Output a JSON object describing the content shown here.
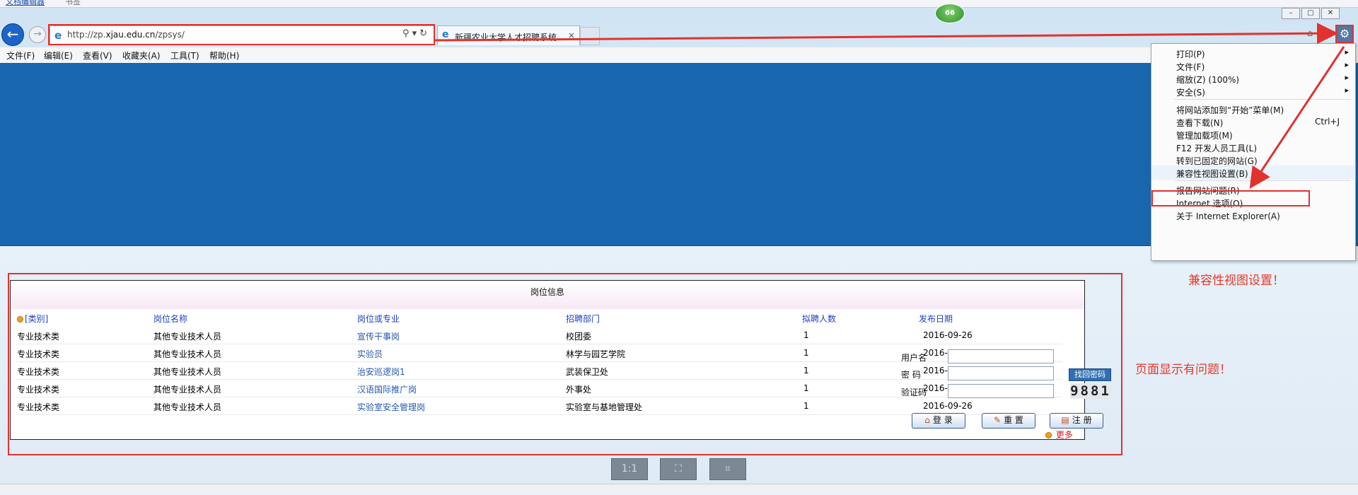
{
  "topbar": {
    "link_text": "文档编辑器",
    "sep_text": "书签",
    "badge": "66"
  },
  "browser": {
    "url_prefix": "http://zp.",
    "url_domain": "xjau.edu.cn",
    "url_path": "/zpsys/",
    "tab_title": "新疆农业大学人才招聘系统",
    "tab_close": "×"
  },
  "menubar": [
    "文件(F)",
    "编辑(E)",
    "查看(V)",
    "收藏夹(A)",
    "工具(T)",
    "帮助(H)"
  ],
  "panel": {
    "title": "岗位信息",
    "headers": [
      "[类别]",
      "岗位名称",
      "岗位或专业",
      "招聘部门",
      "拟聘人数",
      "发布日期"
    ],
    "rows": [
      [
        "专业技术类",
        "其他专业技术人员",
        "宣传干事岗",
        "校团委",
        "1",
        "2016-09-26"
      ],
      [
        "专业技术类",
        "其他专业技术人员",
        "实验员",
        "林学与园艺学院",
        "1",
        "2016-"
      ],
      [
        "专业技术类",
        "其他专业技术人员",
        "治安巡逻岗1",
        "武装保卫处",
        "1",
        "2016-"
      ],
      [
        "专业技术类",
        "其他专业技术人员",
        "汉语国际推广岗",
        "外事处",
        "1",
        "2016-"
      ],
      [
        "专业技术类",
        "其他专业技术人员",
        "实验室安全管理岗",
        "实验室与基地管理处",
        "1",
        "2016-09-26"
      ]
    ]
  },
  "login": {
    "user_label": "用户名",
    "pwd_label": "密  码",
    "code_label": "验证码",
    "find_password": "找回密码",
    "captcha": "9881",
    "login_btn": "登 录",
    "reset_btn": "重 置",
    "register_btn": "注 册",
    "more": "更多"
  },
  "tools_menu": {
    "items": [
      {
        "label": "打印(P)",
        "shortcut": "",
        "arrow": "▸"
      },
      {
        "label": "文件(F)",
        "shortcut": "",
        "arrow": "▸"
      },
      {
        "label": "缩放(Z) (100%)",
        "shortcut": "",
        "arrow": "▸"
      },
      {
        "label": "安全(S)",
        "shortcut": "",
        "arrow": "▸"
      },
      {
        "label": "将网站添加到“开始”菜单(M)",
        "shortcut": "",
        "arrow": ""
      },
      {
        "label": "查看下载(N)",
        "shortcut": "Ctrl+J",
        "arrow": ""
      },
      {
        "label": "管理加载项(M)",
        "shortcut": "",
        "arrow": ""
      },
      {
        "label": "F12 开发人员工具(L)",
        "shortcut": "",
        "arrow": ""
      },
      {
        "label": "转到已固定的网站(G)",
        "shortcut": "",
        "arrow": ""
      },
      {
        "label": "兼容性视图设置(B)",
        "shortcut": "",
        "arrow": ""
      },
      {
        "label": "报告网站问题(R)",
        "shortcut": "",
        "arrow": ""
      },
      {
        "label": "Internet 选项(O)",
        "shortcut": "",
        "arrow": ""
      },
      {
        "label": "关于 Internet Explorer(A)",
        "shortcut": "",
        "arrow": ""
      }
    ]
  },
  "annotations": {
    "compat_note": "兼容性视图设置！",
    "page_problem_note": "页面显示有问题！"
  },
  "viewer": {
    "one_to_one": "1:1"
  },
  "colors": {
    "accent_red": "#e2322e",
    "page_blue": "#1766ae",
    "link_blue": "#2458b0"
  }
}
